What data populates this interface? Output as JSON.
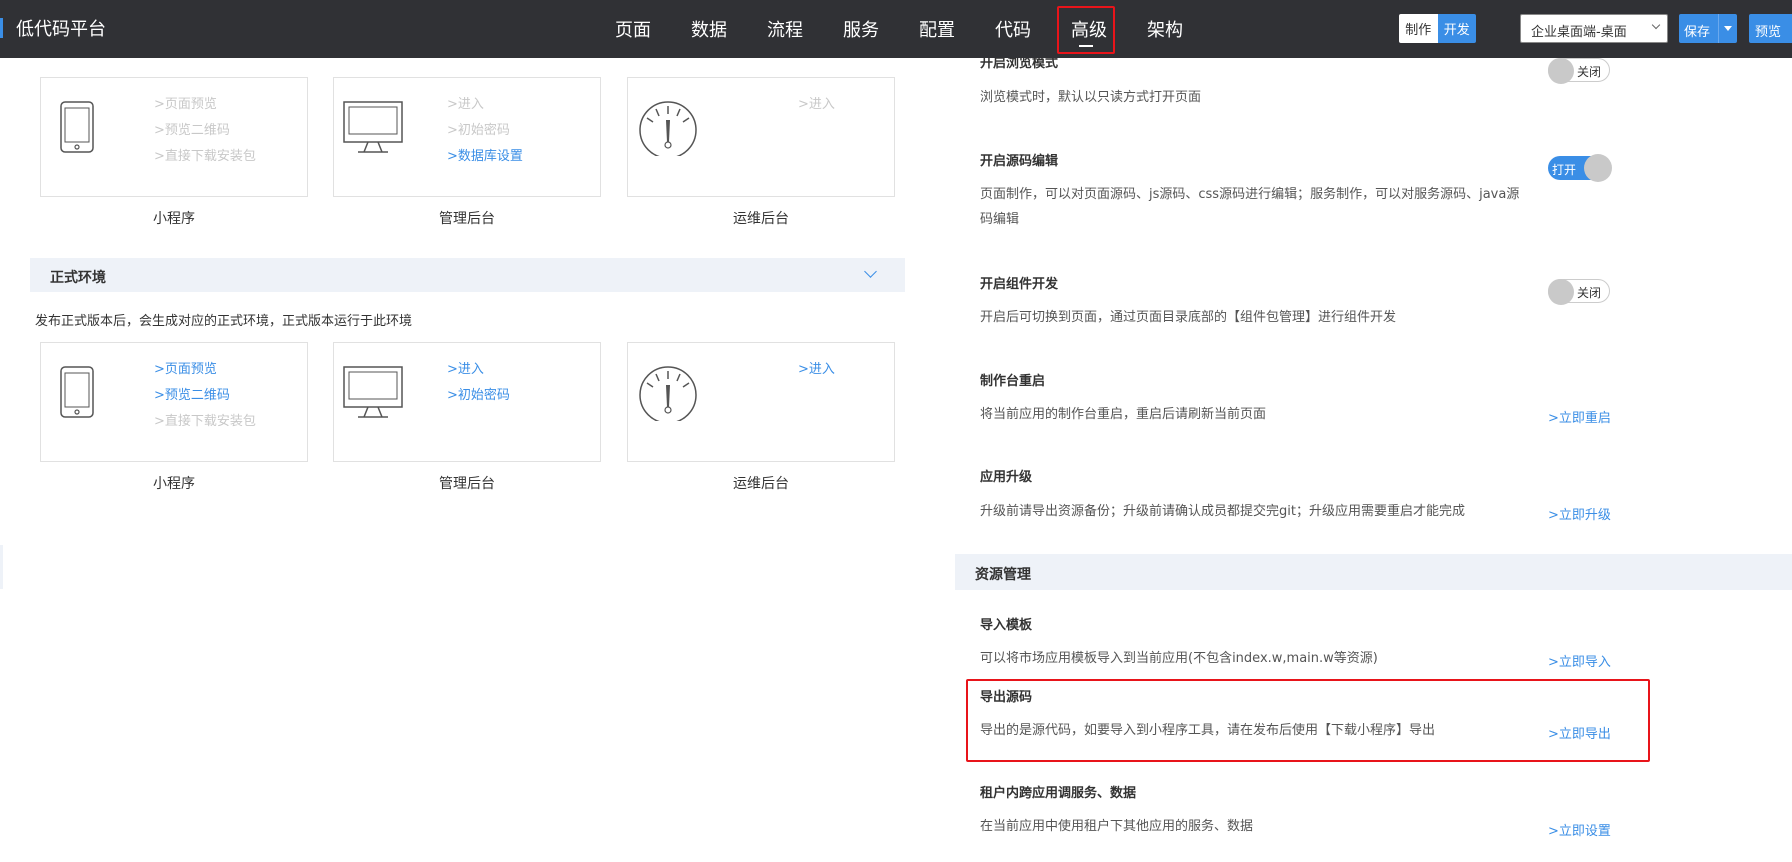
{
  "app": {
    "title": "低代码平台"
  },
  "nav": {
    "items": [
      "页面",
      "数据",
      "流程",
      "服务",
      "配置",
      "代码",
      "高级",
      "架构"
    ],
    "active": "高级"
  },
  "mode": {
    "make": "制作",
    "dev": "开发"
  },
  "env_select": {
    "value": "企业桌面端-桌面"
  },
  "actions": {
    "save": "保存",
    "preview": "预览"
  },
  "test_env": {
    "cards": [
      {
        "label": "小程序",
        "links": [
          {
            "text": ">页面预览",
            "enabled": false
          },
          {
            "text": ">预览二维码",
            "enabled": false
          },
          {
            "text": ">直接下载安装包",
            "enabled": false
          }
        ]
      },
      {
        "label": "管理后台",
        "links": [
          {
            "text": ">进入",
            "enabled": false
          },
          {
            "text": ">初始密码",
            "enabled": false
          },
          {
            "text": ">数据库设置",
            "enabled": true
          }
        ]
      },
      {
        "label": "运维后台",
        "links": [
          {
            "text": ">进入",
            "enabled": false
          }
        ]
      }
    ]
  },
  "prod_env": {
    "title": "正式环境",
    "desc": "发布正式版本后，会生成对应的正式环境，正式版本运行于此环境",
    "cards": [
      {
        "label": "小程序",
        "links": [
          {
            "text": ">页面预览",
            "enabled": true
          },
          {
            "text": ">预览二维码",
            "enabled": true
          },
          {
            "text": ">直接下载安装包",
            "enabled": false
          }
        ]
      },
      {
        "label": "管理后台",
        "links": [
          {
            "text": ">进入",
            "enabled": true
          },
          {
            "text": ">初始密码",
            "enabled": true
          }
        ]
      },
      {
        "label": "运维后台",
        "links": [
          {
            "text": ">进入",
            "enabled": true
          }
        ]
      }
    ]
  },
  "settings": {
    "browse_mode": {
      "title": "开启浏览模式",
      "desc": "浏览模式时，默认以只读方式打开页面",
      "toggle": "关闭"
    },
    "source_edit": {
      "title": "开启源码编辑",
      "desc": "页面制作，可以对页面源码、js源码、css源码进行编辑；服务制作，可以对服务源码、java源码编辑",
      "toggle": "打开"
    },
    "component_dev": {
      "title": "开启组件开发",
      "desc": "开启后可切换到页面，通过页面目录底部的【组件包管理】进行组件开发",
      "toggle": "关闭"
    },
    "restart": {
      "title": "制作台重启",
      "desc": "将当前应用的制作台重启，重启后请刷新当前页面",
      "link": ">立即重启"
    },
    "upgrade": {
      "title": "应用升级",
      "desc": "升级前请导出资源备份；升级前请确认成员都提交完git；升级应用需要重启才能完成",
      "link": ">立即升级"
    }
  },
  "resources": {
    "title": "资源管理",
    "import_tpl": {
      "title": "导入模板",
      "desc": "可以将市场应用模板导入到当前应用(不包含index.w,main.w等资源)",
      "link": ">立即导入"
    },
    "export_src": {
      "title": "导出源码",
      "desc": "导出的是源代码，如要导入到小程序工具，请在发布后使用【下载小程序】导出",
      "link": ">立即导出"
    },
    "cross_app": {
      "title": "租户内跨应用调服务、数据",
      "desc": "在当前应用中使用租户下其他应用的服务、数据",
      "link": ">立即设置"
    }
  },
  "colors": {
    "topbar": "#303135",
    "accent": "#3a8ee6",
    "highlight": "#e8141a"
  }
}
